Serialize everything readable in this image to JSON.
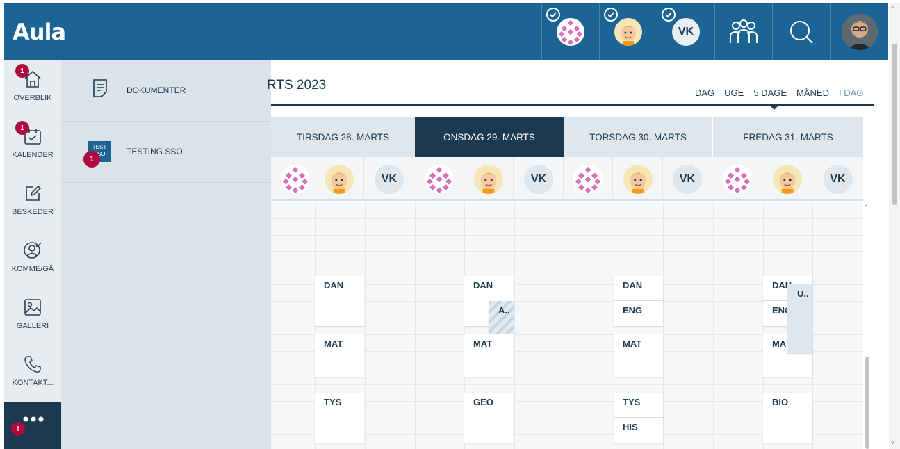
{
  "app": {
    "logo": "Aula"
  },
  "header": {
    "profile_vk": "VK"
  },
  "nav": {
    "items": [
      {
        "label": "OVERBLIK",
        "badge": "1",
        "icon": "home-icon"
      },
      {
        "label": "KALENDER",
        "badge": "1",
        "icon": "calendar-icon"
      },
      {
        "label": "BESKEDER",
        "icon": "edit-icon"
      },
      {
        "label": "KOMME/GÅ",
        "icon": "person-check-icon"
      },
      {
        "label": "GALLERI",
        "icon": "image-icon"
      },
      {
        "label": "KONTAKT...",
        "icon": "phone-icon"
      }
    ],
    "more_badge": "!"
  },
  "flyout": {
    "items": [
      {
        "label": "DOKUMENTER",
        "icon": "document-icon"
      },
      {
        "label": "TESTING SSO",
        "tile_text": "TEST SSO",
        "badge": "1"
      }
    ]
  },
  "calendar": {
    "title": "RTS 2023",
    "views": [
      "DAG",
      "UGE",
      "5 DAGE",
      "MÅNED",
      "I DAG"
    ],
    "active_view": "5 DAGE",
    "days": [
      {
        "label": "TIRSDAG 28. MARTS",
        "active": false
      },
      {
        "label": "ONSDAG 29. MARTS",
        "active": true
      },
      {
        "label": "TORSDAG 30. MARTS",
        "active": false
      },
      {
        "label": "FREDAG 31. MARTS",
        "active": false
      }
    ],
    "vk": "VK",
    "events": {
      "tue": [
        "DAN",
        "MAT",
        "TYS"
      ],
      "wed": [
        "DAN",
        "MAT",
        "GEO"
      ],
      "wed_overlay": "A..",
      "thu": [
        "DAN",
        "ENG",
        "MAT",
        "TYS",
        "HIS"
      ],
      "fri": [
        "DAN",
        "ENG",
        "MA",
        "BIO"
      ],
      "fri_overlay": "U.."
    }
  },
  "colors": {
    "brand": "#1b6493",
    "dark": "#1b3a52",
    "badge": "#b0093f"
  }
}
